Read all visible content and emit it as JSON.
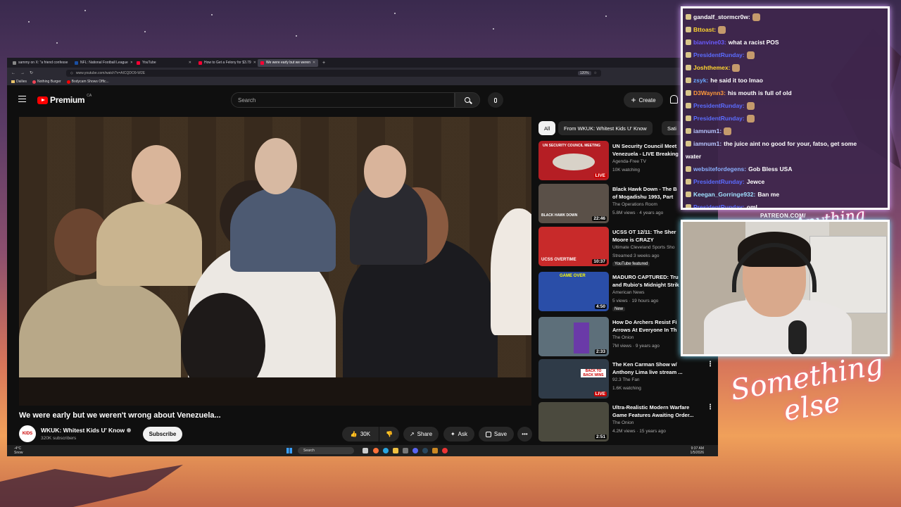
{
  "browser": {
    "tabs": [
      {
        "label": "sammy on X: \"a friend confesse",
        "active": false
      },
      {
        "label": "NFL: National Football League",
        "active": false
      },
      {
        "label": "YouTube",
        "active": false
      },
      {
        "label": "How to Get a Felony for $3.79",
        "active": false
      },
      {
        "label": "We were early but we weren",
        "active": true
      }
    ],
    "url": "www.youtube.com/watch?v=AICQDO9-W2E",
    "zoom": "120%",
    "bookmarks": [
      "Dailies",
      "Nothing Burger",
      "Bodycam Shows Offic..."
    ]
  },
  "youtube": {
    "logo_text": "Premium",
    "region": "CA",
    "search_placeholder": "Search",
    "create_label": "Create",
    "video_title": "We were early but we weren't wrong about Venezuela...",
    "channel": {
      "avatar_text": "KIDS",
      "name": "WKUK: Whitest Kids U' Know",
      "subscribers": "320K subscribers"
    },
    "subscribe_label": "Subscribe",
    "actions": {
      "likes": "30K",
      "share": "Share",
      "ask": "Ask",
      "save": "Save"
    },
    "chips": [
      "All",
      "From WKUK: Whitest Kids U' Know",
      "Sati"
    ],
    "recommendations": [
      {
        "title": "UN Security Council Meet\nVenezuela - LIVE Breaking",
        "channel": "Agenda-Free TV",
        "meta": "10K watching",
        "duration": "LIVE",
        "live": true,
        "thumb": "#b51e24",
        "thumb_text": "UN SECURITY COUNCIL MEETING",
        "badge": ""
      },
      {
        "title": "Black Hawk Down - The B\nof Mogadishu 1993, Part",
        "channel": "The Operations Room",
        "meta": "5.8M views · 4 years ago",
        "duration": "22:46",
        "live": false,
        "thumb": "#5a5048",
        "thumb_text": "BLACK HAWK DOWN",
        "badge": ""
      },
      {
        "title": "UCSS OT 12/11: The Sher\nMoore is CRAZY",
        "channel": "Ultimate Cleveland Sports Sho",
        "meta": "Streamed 3 weeks ago",
        "duration": "10:37",
        "live": false,
        "thumb": "#c82a2a",
        "thumb_text": "UCSS OVERTIME",
        "badge": "YouTube featured"
      },
      {
        "title": "MADURO CAPTURED: Tru\nand Rubio's Midnight Strik",
        "channel": "American News",
        "meta": "5 views · 19 hours ago",
        "duration": "4:50",
        "live": false,
        "thumb": "#2a4ea8",
        "thumb_text": "GAME OVER",
        "badge": "New"
      },
      {
        "title": "How Do Archers Resist Fi\nArrows At Everyone In Th",
        "channel": "The Onion",
        "meta": "7M views · 9 years ago",
        "duration": "2:33",
        "live": false,
        "thumb": "#5d6f7a",
        "thumb_text": "",
        "badge": ""
      },
      {
        "title": "The Ken Carman Show w/\nAnthony Lima live stream ...",
        "channel": "92.3 The Fan",
        "meta": "1.6K watching",
        "duration": "LIVE",
        "live": true,
        "thumb": "#2f3b48",
        "thumb_text": "BACK TO BACK WINS",
        "badge": ""
      },
      {
        "title": "Ultra-Realistic Modern Warfare\nGame Features Awaiting Order...",
        "channel": "The Onion",
        "meta": "4.2M views · 15 years ago",
        "duration": "2:51",
        "live": false,
        "thumb": "#4b4a3e",
        "thumb_text": "",
        "badge": ""
      }
    ]
  },
  "taskbar": {
    "weather_temp": "-4°C",
    "weather_desc": "Snow",
    "search": "Search",
    "time": "9:37 AM",
    "date": "1/5/2026"
  },
  "chat": {
    "messages": [
      {
        "user": "gandalf_stormcr0w:",
        "text": "",
        "color": "#ffffff",
        "emote": true
      },
      {
        "user": "Bttoast:",
        "text": "",
        "color": "#ffd52e",
        "emote": true
      },
      {
        "user": "bianvine03:",
        "text": "what a racist POS",
        "color": "#6a5bff",
        "emote": false
      },
      {
        "user": "PresidentRunday:",
        "text": "",
        "color": "#5b6cff",
        "emote": true
      },
      {
        "user": "Joshthemex:",
        "text": "",
        "color": "#ffd52e",
        "emote": true
      },
      {
        "user": "zsyk:",
        "text": "he said it too lmao",
        "color": "#6aa8ff",
        "emote": false
      },
      {
        "user": "D3Waynn3:",
        "text": "his mouth is full of old",
        "color": "#ff9a3a",
        "emote": false
      },
      {
        "user": "PresidentRunday:",
        "text": "",
        "color": "#5b6cff",
        "emote": true
      },
      {
        "user": "PresidentRunday:",
        "text": "",
        "color": "#5b6cff",
        "emote": true
      },
      {
        "user": "iamnum1:",
        "text": "",
        "color": "#b8c6ff",
        "emote": true
      },
      {
        "user": "iamnum1:",
        "text": "the juice aint no good for your, fatso, get some",
        "color": "#b8c6ff",
        "emote": false
      },
      {
        "user": "",
        "text": "water",
        "color": "#ffffff",
        "emote": false
      },
      {
        "user": "websitefordegens:",
        "text": "Gob Bless USA",
        "color": "#8ab0ff",
        "emote": false
      },
      {
        "user": "PresidentRunday:",
        "text": "Jewce",
        "color": "#5b6cff",
        "emote": false
      },
      {
        "user": "Keegan_Gorringe932:",
        "text": "Ban me",
        "color": "#9fe0ff",
        "emote": false
      },
      {
        "user": "PresidentRunday:",
        "text": "oml",
        "color": "#5b6cff",
        "emote": false
      }
    ]
  },
  "overlay": {
    "patreon": "PATREON.COM/",
    "logo_small": "Anything else?",
    "logo_big": "Something else"
  },
  "colors": {
    "youtube_red": "#ff0000",
    "yt_bg": "#0f0f0f",
    "chat_border": "#ffffff"
  }
}
